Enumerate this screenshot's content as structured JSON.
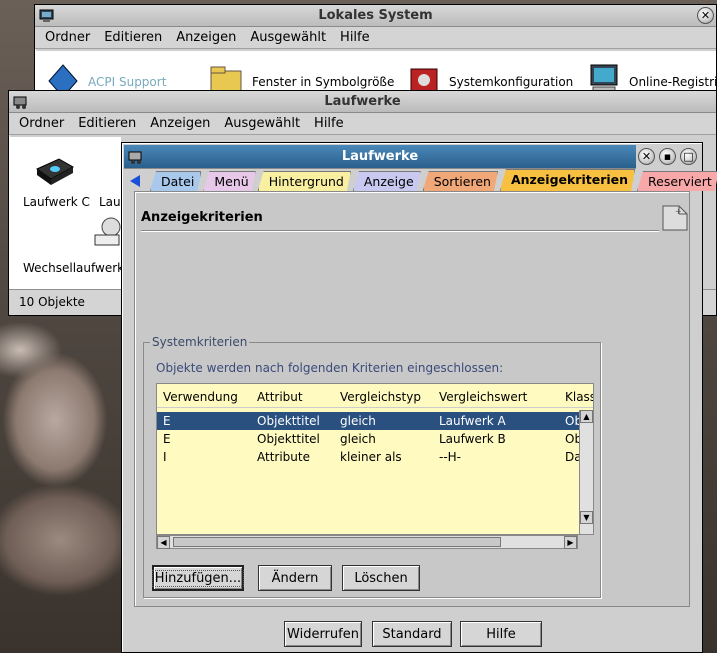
{
  "back_window": {
    "title": "Lokales System",
    "menu": [
      "Ordner",
      "Editieren",
      "Anzeigen",
      "Ausgewählt",
      "Hilfe"
    ],
    "icons": [
      {
        "label": "ACPI Support"
      },
      {
        "label": "Fenster in Symbolgröße"
      },
      {
        "label": "Systemkonfiguration"
      },
      {
        "label": "Online-Registrie"
      }
    ]
  },
  "mid_window": {
    "title": "Laufwerke",
    "menu": [
      "Ordner",
      "Editieren",
      "Anzeigen",
      "Ausgewählt",
      "Hilfe"
    ],
    "icons": [
      {
        "label": "Laufwerk C"
      },
      {
        "label": "Lau"
      },
      {
        "label": "Wechsellaufwerk"
      }
    ],
    "status": "10 Objekte"
  },
  "dialog": {
    "title": "Laufwerke",
    "tabs": [
      "Datei",
      "Menü",
      "Hintergrund",
      "Anzeige",
      "Sortieren",
      "Anzeigekriterien",
      "Reserviert"
    ],
    "page_title": "Anzeigekriterien",
    "group_title": "Systemkriterien",
    "description": "Objekte werden nach folgenden Kriterien eingeschlossen:",
    "columns": [
      "Verwendung",
      "Attribut",
      "Vergleichstyp",
      "Vergleichswert",
      "Klass"
    ],
    "rows": [
      [
        "E",
        "Objekttitel",
        "gleich",
        "Laufwerk A",
        "Ob"
      ],
      [
        "E",
        "Objekttitel",
        "gleich",
        "Laufwerk B",
        "Ob"
      ],
      [
        "I",
        "Attribute",
        "kleiner als",
        "--H-",
        "Da"
      ]
    ],
    "selected_row": 0,
    "buttons": {
      "add": "Hinzufügen...",
      "change": "Ändern",
      "delete": "Löschen",
      "undo": "Widerrufen",
      "default": "Standard",
      "help": "Hilfe"
    },
    "colors": {
      "accent": "#2a5f8c",
      "table_bg": "#fffbc0",
      "active_tab": "#f8c040"
    }
  }
}
